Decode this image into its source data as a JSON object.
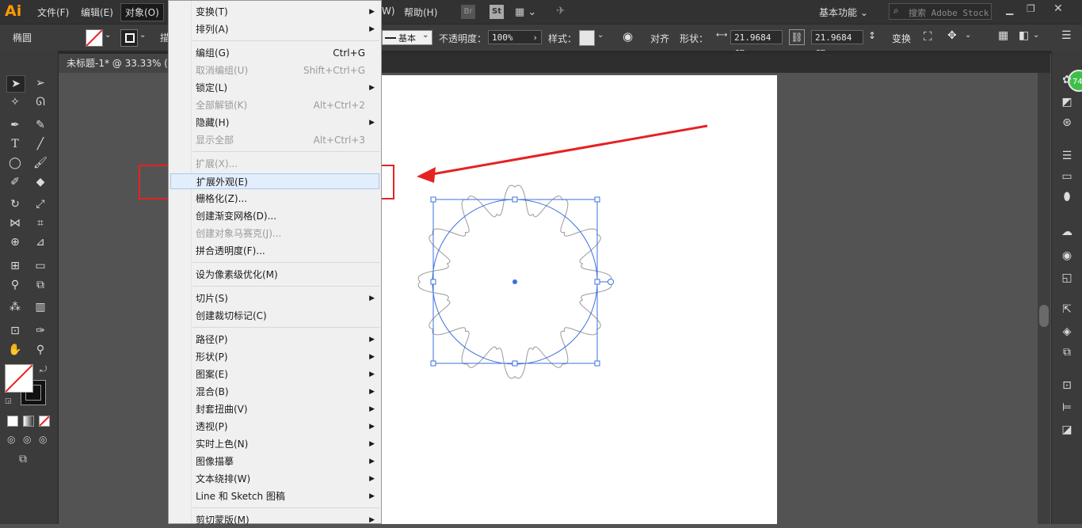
{
  "app": {
    "logo": "Ai"
  },
  "menubar": {
    "items": [
      "文件(F)",
      "编辑(E)",
      "对象(O)",
      "W)",
      "帮助(H)"
    ],
    "br": "Br",
    "st": "St",
    "workspace": "基本功能",
    "search_placeholder": "搜索 Adobe Stock"
  },
  "control": {
    "object_type": "椭圆",
    "stroke_short": "描",
    "stroke_style": "基本",
    "opacity_label": "不透明度：",
    "opacity_value": "100%",
    "style_label": "样式：",
    "align": "对齐",
    "shape_label": "形状：",
    "width_value": "21.9684 cm",
    "height_value": "21.9684 cm",
    "transform": "变换"
  },
  "document": {
    "tab_title": "未标题-1* @ 33.33% ("
  },
  "object_menu": {
    "items": [
      {
        "label": "变换(T)",
        "shortcut": "",
        "submenu": true,
        "disabled": false
      },
      {
        "label": "排列(A)",
        "shortcut": "",
        "submenu": true,
        "disabled": false
      },
      {
        "label": "编组(G)",
        "shortcut": "Ctrl+G",
        "submenu": false,
        "disabled": false
      },
      {
        "label": "取消编组(U)",
        "shortcut": "Shift+Ctrl+G",
        "submenu": false,
        "disabled": true
      },
      {
        "label": "锁定(L)",
        "shortcut": "",
        "submenu": true,
        "disabled": false
      },
      {
        "label": "全部解锁(K)",
        "shortcut": "Alt+Ctrl+2",
        "submenu": false,
        "disabled": true
      },
      {
        "label": "隐藏(H)",
        "shortcut": "",
        "submenu": true,
        "disabled": false
      },
      {
        "label": "显示全部",
        "shortcut": "Alt+Ctrl+3",
        "submenu": false,
        "disabled": true
      },
      {
        "label": "扩展(X)...",
        "shortcut": "",
        "submenu": false,
        "disabled": true
      },
      {
        "label": "扩展外观(E)",
        "shortcut": "",
        "submenu": false,
        "disabled": false
      },
      {
        "label": "栅格化(Z)...",
        "shortcut": "",
        "submenu": false,
        "disabled": false
      },
      {
        "label": "创建渐变网格(D)...",
        "shortcut": "",
        "submenu": false,
        "disabled": false
      },
      {
        "label": "创建对象马赛克(J)...",
        "shortcut": "",
        "submenu": false,
        "disabled": true
      },
      {
        "label": "拼合透明度(F)...",
        "shortcut": "",
        "submenu": false,
        "disabled": false
      },
      {
        "label": "设为像素级优化(M)",
        "shortcut": "",
        "submenu": false,
        "disabled": false
      },
      {
        "label": "切片(S)",
        "shortcut": "",
        "submenu": true,
        "disabled": false
      },
      {
        "label": "创建裁切标记(C)",
        "shortcut": "",
        "submenu": false,
        "disabled": false
      },
      {
        "label": "路径(P)",
        "shortcut": "",
        "submenu": true,
        "disabled": false
      },
      {
        "label": "形状(P)",
        "shortcut": "",
        "submenu": true,
        "disabled": false
      },
      {
        "label": "图案(E)",
        "shortcut": "",
        "submenu": true,
        "disabled": false
      },
      {
        "label": "混合(B)",
        "shortcut": "",
        "submenu": true,
        "disabled": false
      },
      {
        "label": "封套扭曲(V)",
        "shortcut": "",
        "submenu": true,
        "disabled": false
      },
      {
        "label": "透视(P)",
        "shortcut": "",
        "submenu": true,
        "disabled": false
      },
      {
        "label": "实时上色(N)",
        "shortcut": "",
        "submenu": true,
        "disabled": false
      },
      {
        "label": "图像描摹",
        "shortcut": "",
        "submenu": true,
        "disabled": false
      },
      {
        "label": "文本绕排(W)",
        "shortcut": "",
        "submenu": true,
        "disabled": false
      },
      {
        "label": "Line 和 Sketch 图稿",
        "shortcut": "",
        "submenu": true,
        "disabled": false
      },
      {
        "label": "剪切蒙版(M)",
        "shortcut": "",
        "submenu": true,
        "disabled": false
      }
    ]
  },
  "badge": {
    "value": "74"
  },
  "colors": {
    "accent_red": "#e52222",
    "selection_blue": "#3d6fe0",
    "logo_orange": "#ff9a00"
  }
}
